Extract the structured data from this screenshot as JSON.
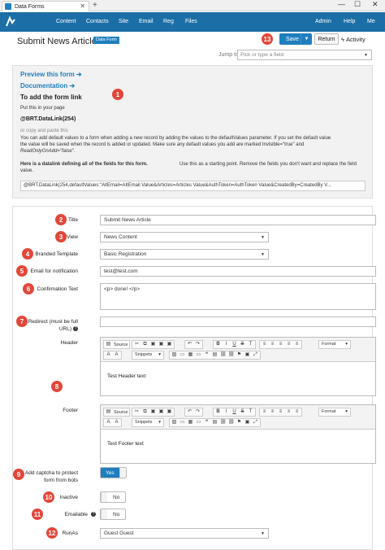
{
  "window": {
    "tab_title": "Data Forms",
    "tab_close": "✕",
    "new_tab": "+",
    "minimize": "—",
    "maximize": "☐",
    "close": "✕"
  },
  "nav": {
    "items": [
      "Content",
      "Contacts",
      "Site",
      "Email",
      "Reg",
      "Files"
    ],
    "right": [
      "Admin",
      "Help",
      "Me"
    ]
  },
  "header": {
    "title": "Submit News Article",
    "badge": "Data Form",
    "save": "Save",
    "return": "Return",
    "activity": "Activity",
    "jump_label": "Jump to",
    "jump_placeholder": "Pick or type a field"
  },
  "info": {
    "preview": "Preview this form ➔",
    "documentation": "Documentation ➔",
    "add_link_title": "To add the form link",
    "put_this": "Put this in your page",
    "code": "@BRT.DataLink(254)",
    "or_copy": "or copy and paste this",
    "default_text_1": "You can add default values to a form when adding a new record by adding the values to the defaultValues parameter. If you set the default value",
    "default_text_2": "the value will be saved when the record is added or updated. Make sure any default values you add are marked Invisible=\"true\" and",
    "default_text_3": "ReadOnlyOnAdd=\"false\".",
    "datalink_bold": "Here is a datalink defining all of the fields for this form.",
    "datalink_rest": " Use this as a starting point. Remove the fields you don't want and replace the field",
    "datalink_text_2": "value.",
    "datalink_code": "@BRT.DataLink(254,defaultValues:\"AltEmail=AltEmail Value&Articles=Articles Value&AuthToken=AuthToken Value&CreatedBy=CreatedBy V..."
  },
  "form": {
    "title_label": "Title",
    "title_value": "Submit News Article",
    "view_label": "View",
    "view_value": "News Content",
    "template_label": "Branded Template",
    "template_value": "Basic Registration",
    "email_label": "Email for notification",
    "email_value": "test@test.com",
    "confirm_label": "Confirmation Text",
    "confirm_value": "<p> done! </p>",
    "redirect_label_1": "Redirect (must be full",
    "redirect_label_2": "URL)",
    "header_label": "Header",
    "header_value": "Test Header text",
    "footer_label": "Footer",
    "footer_value": "Test Footer text",
    "captcha_label_1": "Add captcha to protect",
    "captcha_label_2": "form from bots",
    "captcha_value": "Yes",
    "inactive_label": "Inactive",
    "inactive_value": "No",
    "emailable_label": "Emailable",
    "emailable_value": "No",
    "runas_label": "RunAs",
    "runas_value": "Guest Guest"
  },
  "editor": {
    "source": "Source",
    "snippets": "Snippets",
    "format": "Format",
    "bold": "B",
    "italic": "I",
    "underline": "U",
    "strike": "S",
    "text_color": "A",
    "bg_color": "A"
  },
  "callouts": [
    "1",
    "6",
    "2",
    "3",
    "4",
    "5",
    "7",
    "8",
    "9",
    "10",
    "11",
    "12",
    "13"
  ],
  "colors": {
    "nav": "#1c6ea6",
    "accent": "#1e7fbf",
    "callout": "#e2473a"
  }
}
